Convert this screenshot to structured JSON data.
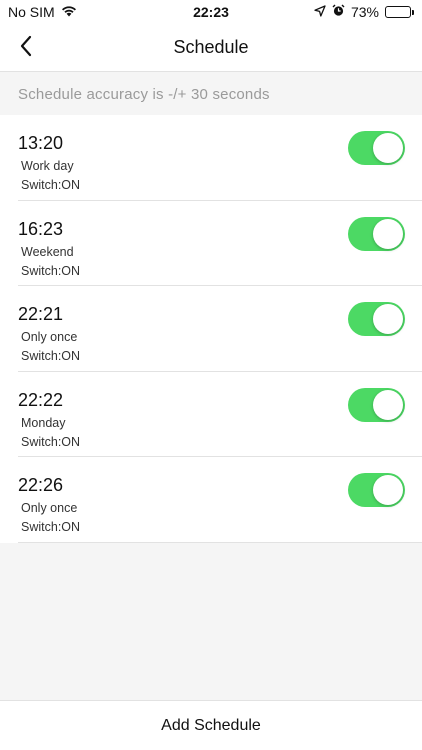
{
  "status_bar": {
    "carrier": "No SIM",
    "time": "22:23",
    "battery_percent": "73%",
    "battery_level": 0.73,
    "icons": [
      "wifi-icon",
      "location-arrow-icon",
      "alarm-icon",
      "battery-icon"
    ]
  },
  "nav": {
    "title": "Schedule",
    "back_icon": "chevron-left-icon"
  },
  "accuracy_note": "Schedule accuracy is -/+ 30 seconds",
  "schedules": [
    {
      "time": "13:20",
      "repeat": "Work day",
      "action": "Switch:ON",
      "enabled": true
    },
    {
      "time": "16:23",
      "repeat": "Weekend",
      "action": "Switch:ON",
      "enabled": true
    },
    {
      "time": "22:21",
      "repeat": "Only once",
      "action": "Switch:ON",
      "enabled": true
    },
    {
      "time": "22:22",
      "repeat": "Monday",
      "action": "Switch:ON",
      "enabled": true
    },
    {
      "time": "22:26",
      "repeat": "Only once",
      "action": "Switch:ON",
      "enabled": true
    }
  ],
  "footer": {
    "add_label": "Add Schedule"
  },
  "colors": {
    "toggle_on": "#4cd964",
    "background": "#f5f5f5",
    "note_text": "#9a9a9a"
  }
}
